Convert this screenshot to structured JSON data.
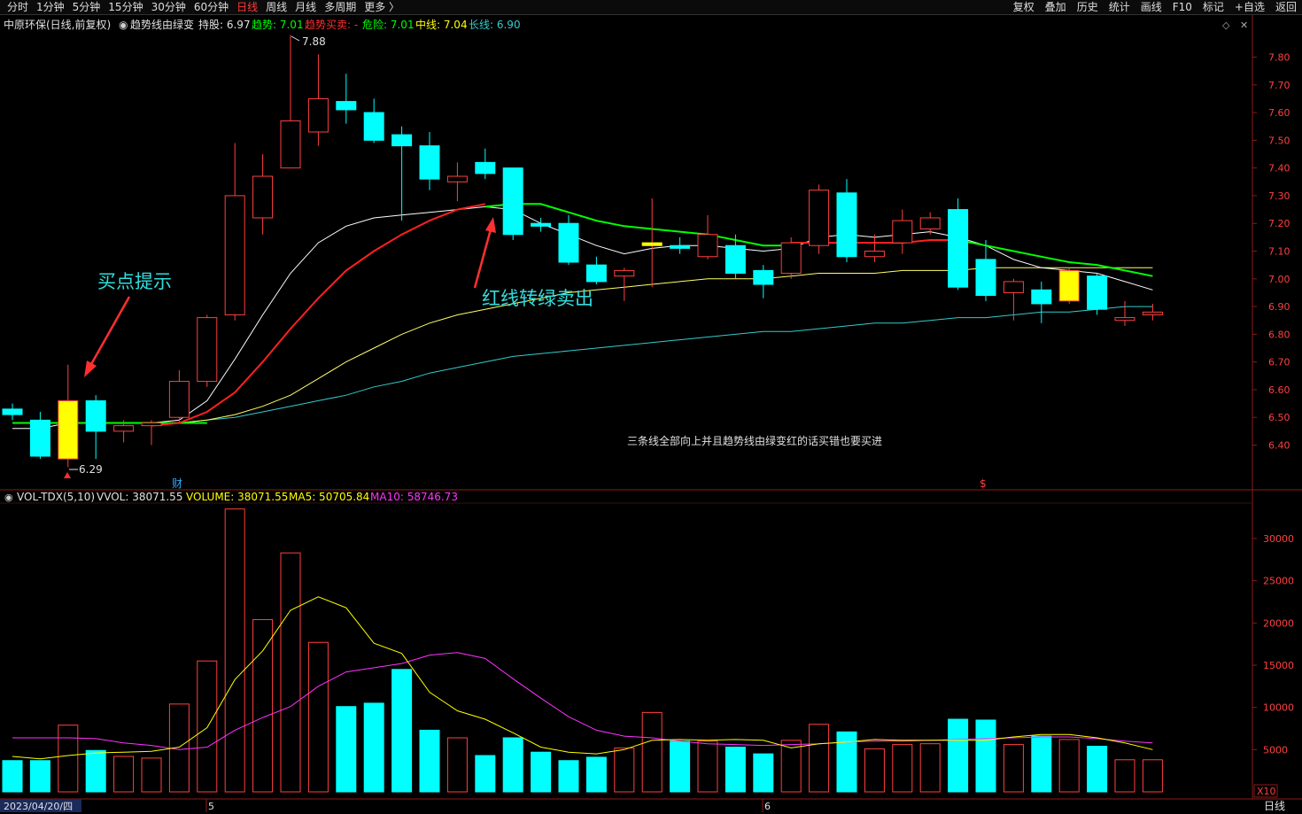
{
  "toolbar": {
    "periods": [
      "分时",
      "1分钟",
      "5分钟",
      "15分钟",
      "30分钟",
      "60分钟",
      "日线",
      "周线",
      "月线",
      "多周期",
      "更多 〉"
    ],
    "active_period": "日线",
    "actions": [
      "复权",
      "叠加",
      "历史",
      "统计",
      "画线",
      "F10",
      "标记",
      "+自选",
      "返回"
    ]
  },
  "price_header": {
    "stock": "中原环保(日线,前复权)",
    "indicator": "趋势线由绿变",
    "hold_label": "持股: 6.97",
    "trend_label": "趋势: 7.01",
    "buysell_label": "趋势买卖: -",
    "danger_label": "危险: 7.01",
    "mid_label": "中线: 7.04",
    "long_label": "长线: 6.90"
  },
  "annotations": {
    "buy_hint": "买点提示",
    "sell_hint": "红线转绿卖出",
    "note": "三条线全部向上并且趋势线由绿变红的话买错也要买进",
    "high_label": "7.88",
    "low_label": "6.29",
    "fin_marker": "财",
    "s_marker": "$"
  },
  "volume_header": {
    "name": "VOL-TDX(5,10)",
    "vvol": "VVOL: 38071.55",
    "volume": "VOLUME: 38071.55",
    "ma5": "MA5: 50705.84",
    "ma10": "MA10: 58746.73"
  },
  "bottom": {
    "date": "2023/04/20/四",
    "month5": "5",
    "month6": "6",
    "period": "日线",
    "scale": "X10"
  },
  "colors": {
    "up": "#ff4040",
    "down": "#00ffff",
    "yellow": "#ffff00",
    "white_line": "#ffffff",
    "red_line": "#ff2020",
    "green_line": "#00ff00",
    "mid_line": "#ffff66",
    "long_line": "#33cccc",
    "ma10_vol": "#ff33ff"
  },
  "chart_data": {
    "type": "candlestick",
    "price_ticks": [
      7.8,
      7.7,
      7.6,
      7.5,
      7.4,
      7.3,
      7.2,
      7.1,
      7.0,
      6.9,
      6.8,
      6.7,
      6.6,
      6.5,
      6.4
    ],
    "ylim": [
      6.3,
      7.9
    ],
    "volume_ticks": [
      30000,
      25000,
      20000,
      15000,
      10000,
      5000
    ],
    "volume_ylim": [
      0,
      34000
    ],
    "candles": [
      {
        "o": 6.53,
        "h": 6.55,
        "l": 6.49,
        "c": 6.51,
        "hl": 0,
        "vol": 3700
      },
      {
        "o": 6.49,
        "h": 6.52,
        "l": 6.35,
        "c": 6.36,
        "hl": 0,
        "vol": 3700
      },
      {
        "o": 6.35,
        "h": 6.69,
        "l": 6.32,
        "c": 6.56,
        "hl": 1,
        "vol": 7900
      },
      {
        "o": 6.56,
        "h": 6.58,
        "l": 6.35,
        "c": 6.45,
        "hl": 0,
        "vol": 4900
      },
      {
        "o": 6.45,
        "h": 6.49,
        "l": 6.41,
        "c": 6.47,
        "hl": 0,
        "vol": 4200
      },
      {
        "o": 6.47,
        "h": 6.49,
        "l": 6.4,
        "c": 6.48,
        "hl": 0,
        "vol": 4000
      },
      {
        "o": 6.5,
        "h": 6.67,
        "l": 6.48,
        "c": 6.63,
        "hl": 0,
        "vol": 10400
      },
      {
        "o": 6.63,
        "h": 6.87,
        "l": 6.61,
        "c": 6.86,
        "hl": 0,
        "vol": 15500
      },
      {
        "o": 6.87,
        "h": 7.49,
        "l": 6.85,
        "c": 7.3,
        "hl": 0,
        "vol": 33500
      },
      {
        "o": 7.22,
        "h": 7.45,
        "l": 7.16,
        "c": 7.37,
        "hl": 0,
        "vol": 20400
      },
      {
        "o": 7.4,
        "h": 7.88,
        "l": 7.4,
        "c": 7.57,
        "hl": 0,
        "vol": 28300
      },
      {
        "o": 7.53,
        "h": 7.81,
        "l": 7.48,
        "c": 7.65,
        "hl": 0,
        "vol": 17700
      },
      {
        "o": 7.64,
        "h": 7.74,
        "l": 7.56,
        "c": 7.61,
        "hl": 0,
        "vol": 10100
      },
      {
        "o": 7.6,
        "h": 7.65,
        "l": 7.49,
        "c": 7.5,
        "hl": 0,
        "vol": 10500
      },
      {
        "o": 7.52,
        "h": 7.55,
        "l": 7.21,
        "c": 7.48,
        "hl": 0,
        "vol": 14500
      },
      {
        "o": 7.48,
        "h": 7.53,
        "l": 7.32,
        "c": 7.36,
        "hl": 0,
        "vol": 7300
      },
      {
        "o": 7.35,
        "h": 7.42,
        "l": 7.28,
        "c": 7.37,
        "hl": 0,
        "vol": 6400
      },
      {
        "o": 7.42,
        "h": 7.47,
        "l": 7.36,
        "c": 7.38,
        "hl": 0,
        "vol": 4300
      },
      {
        "o": 7.4,
        "h": 7.4,
        "l": 7.14,
        "c": 7.16,
        "hl": 0,
        "vol": 6400
      },
      {
        "o": 7.2,
        "h": 7.22,
        "l": 7.17,
        "c": 7.19,
        "hl": 0,
        "vol": 4700
      },
      {
        "o": 7.2,
        "h": 7.23,
        "l": 7.05,
        "c": 7.06,
        "hl": 0,
        "vol": 3700
      },
      {
        "o": 7.05,
        "h": 7.08,
        "l": 6.98,
        "c": 6.99,
        "hl": 0,
        "vol": 4100
      },
      {
        "o": 7.01,
        "h": 7.04,
        "l": 6.92,
        "c": 7.03,
        "hl": 0,
        "vol": 5200
      },
      {
        "o": 7.12,
        "h": 7.29,
        "l": 6.97,
        "c": 7.13,
        "hl": 2,
        "vol": 9400
      },
      {
        "o": 7.12,
        "h": 7.15,
        "l": 7.09,
        "c": 7.11,
        "hl": 0,
        "vol": 6000
      },
      {
        "o": 7.08,
        "h": 7.23,
        "l": 7.07,
        "c": 7.16,
        "hl": 0,
        "vol": 6000
      },
      {
        "o": 7.12,
        "h": 7.16,
        "l": 7.0,
        "c": 7.02,
        "hl": 0,
        "vol": 5300
      },
      {
        "o": 7.03,
        "h": 7.05,
        "l": 6.93,
        "c": 6.98,
        "hl": 0,
        "vol": 4500
      },
      {
        "o": 7.02,
        "h": 7.15,
        "l": 7.0,
        "c": 7.13,
        "hl": 0,
        "vol": 6100
      },
      {
        "o": 7.12,
        "h": 7.34,
        "l": 7.09,
        "c": 7.32,
        "hl": 0,
        "vol": 8000
      },
      {
        "o": 7.31,
        "h": 7.36,
        "l": 7.06,
        "c": 7.08,
        "hl": 0,
        "vol": 7100
      },
      {
        "o": 7.08,
        "h": 7.16,
        "l": 7.06,
        "c": 7.1,
        "hl": 0,
        "vol": 5100
      },
      {
        "o": 7.13,
        "h": 7.25,
        "l": 7.09,
        "c": 7.21,
        "hl": 0,
        "vol": 5600
      },
      {
        "o": 7.18,
        "h": 7.24,
        "l": 7.16,
        "c": 7.22,
        "hl": 0,
        "vol": 5700
      },
      {
        "o": 7.25,
        "h": 7.29,
        "l": 6.96,
        "c": 6.97,
        "hl": 0,
        "vol": 8600
      },
      {
        "o": 7.07,
        "h": 7.14,
        "l": 6.92,
        "c": 6.94,
        "hl": 0,
        "vol": 8500
      },
      {
        "o": 6.95,
        "h": 7.0,
        "l": 6.85,
        "c": 6.99,
        "hl": 0,
        "vol": 5600
      },
      {
        "o": 6.96,
        "h": 6.99,
        "l": 6.84,
        "c": 6.91,
        "hl": 0,
        "vol": 6600
      },
      {
        "o": 6.92,
        "h": 7.04,
        "l": 6.91,
        "c": 7.03,
        "hl": 1,
        "vol": 6200
      },
      {
        "o": 7.01,
        "h": 7.02,
        "l": 6.87,
        "c": 6.89,
        "hl": 0,
        "vol": 5400
      },
      {
        "o": 6.85,
        "h": 6.92,
        "l": 6.83,
        "c": 6.86,
        "hl": 0,
        "vol": 3800
      },
      {
        "o": 6.87,
        "h": 6.91,
        "l": 6.85,
        "c": 6.88,
        "hl": 0,
        "vol": 3800
      }
    ],
    "white_line": [
      6.46,
      6.46,
      6.48,
      6.48,
      6.48,
      6.48,
      6.49,
      6.56,
      6.71,
      6.87,
      7.02,
      7.13,
      7.19,
      7.22,
      7.23,
      7.24,
      7.25,
      7.26,
      7.25,
      7.2,
      7.16,
      7.12,
      7.09,
      7.11,
      7.12,
      7.12,
      7.11,
      7.1,
      7.11,
      7.15,
      7.16,
      7.15,
      7.16,
      7.17,
      7.15,
      7.12,
      7.07,
      7.04,
      7.03,
      7.02,
      6.99,
      6.96
    ],
    "red_line": [
      null,
      null,
      null,
      null,
      null,
      6.47,
      6.48,
      6.52,
      6.59,
      6.7,
      6.82,
      6.93,
      7.03,
      7.1,
      7.16,
      7.21,
      7.25,
      7.27,
      null,
      null,
      null,
      null,
      null,
      null,
      null,
      null,
      null,
      null,
      7.13,
      7.13,
      7.13,
      7.13,
      7.13,
      7.14,
      7.14,
      null,
      null,
      null,
      null,
      null,
      null,
      null
    ],
    "green_line": [
      6.48,
      6.48,
      6.48,
      6.48,
      6.48,
      6.48,
      6.48,
      6.48,
      null,
      null,
      null,
      null,
      null,
      null,
      null,
      null,
      null,
      7.26,
      7.27,
      7.27,
      7.24,
      7.21,
      7.19,
      7.18,
      7.17,
      7.16,
      7.14,
      7.12,
      7.12,
      null,
      null,
      null,
      null,
      null,
      7.14,
      7.12,
      7.1,
      7.08,
      7.06,
      7.05,
      7.03,
      7.01
    ],
    "mid_line": [
      6.48,
      6.48,
      6.48,
      6.48,
      6.48,
      6.48,
      6.48,
      6.49,
      6.51,
      6.54,
      6.58,
      6.64,
      6.7,
      6.75,
      6.8,
      6.84,
      6.87,
      6.89,
      6.91,
      6.93,
      6.95,
      6.96,
      6.97,
      6.98,
      6.99,
      7.0,
      7.0,
      7.0,
      7.01,
      7.02,
      7.02,
      7.02,
      7.03,
      7.03,
      7.03,
      7.04,
      7.04,
      7.04,
      7.04,
      7.04,
      7.04,
      7.04
    ],
    "long_line": [
      6.48,
      6.48,
      6.48,
      6.48,
      6.48,
      6.48,
      6.48,
      6.49,
      6.5,
      6.52,
      6.54,
      6.56,
      6.58,
      6.61,
      6.63,
      6.66,
      6.68,
      6.7,
      6.72,
      6.73,
      6.74,
      6.75,
      6.76,
      6.77,
      6.78,
      6.79,
      6.8,
      6.81,
      6.81,
      6.82,
      6.83,
      6.84,
      6.84,
      6.85,
      6.86,
      6.86,
      6.87,
      6.88,
      6.88,
      6.89,
      6.9,
      6.9
    ],
    "vol_ma5": [
      4200,
      3900,
      4300,
      4600,
      4700,
      4800,
      5300,
      7600,
      13300,
      16700,
      21500,
      23100,
      21800,
      17600,
      16400,
      11800,
      9600,
      8600,
      7000,
      5300,
      4700,
      4500,
      5000,
      6100,
      6200,
      6100,
      6200,
      6100,
      5200,
      5700,
      5900,
      6200,
      6100,
      6100,
      6100,
      6100,
      6500,
      6800,
      6800,
      6400,
      5800,
      5000
    ],
    "vol_ma10": [
      6400,
      6400,
      6400,
      6300,
      5800,
      5500,
      5000,
      5300,
      7300,
      8800,
      10100,
      12500,
      14200,
      14700,
      15200,
      16200,
      16500,
      15800,
      13400,
      11100,
      8900,
      7300,
      6600,
      6400,
      6000,
      5700,
      5600,
      5500,
      5600,
      5700,
      5900,
      6000,
      6000,
      6100,
      6200,
      6300,
      6400,
      6500,
      6500,
      6300,
      6000,
      5800
    ]
  }
}
